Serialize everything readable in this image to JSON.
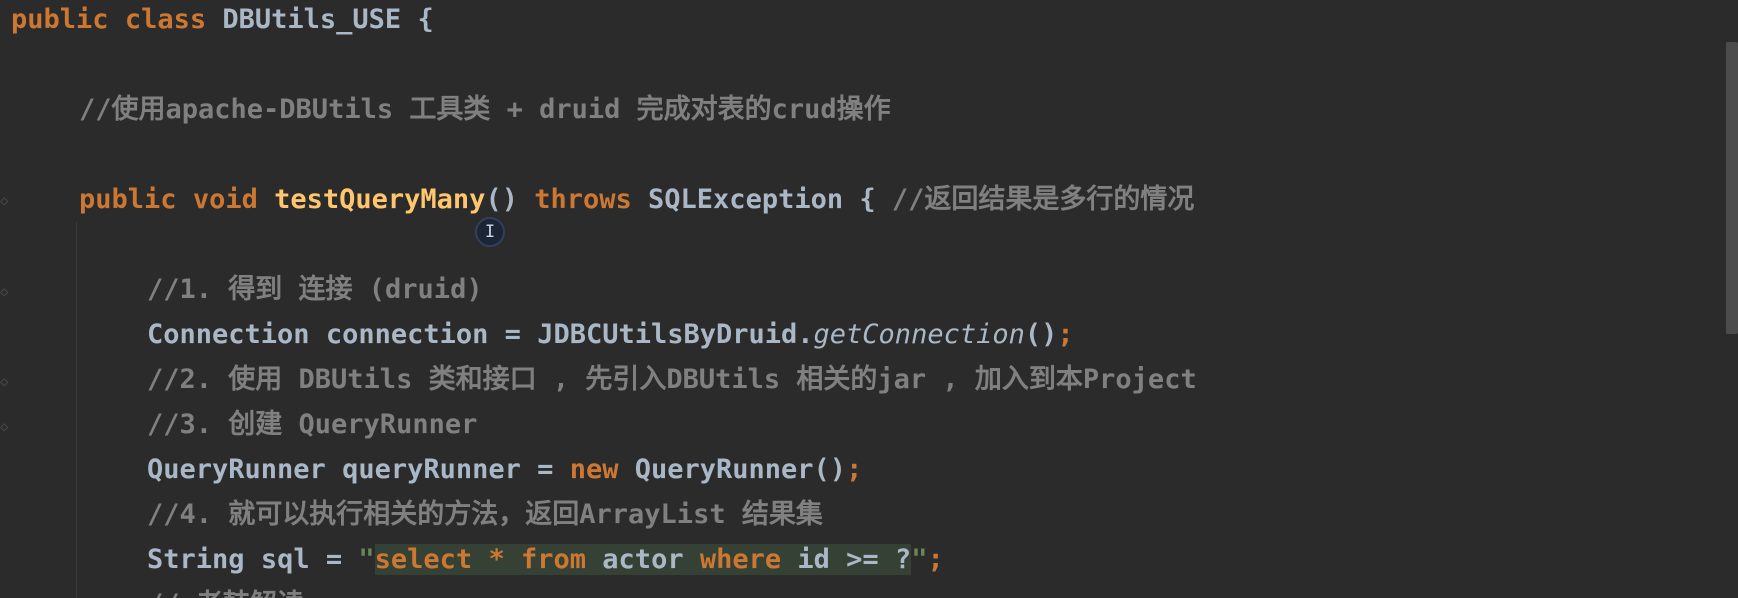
{
  "code": {
    "line1": {
      "kw_public": "public",
      "kw_class": "class",
      "class_name": "DBUtils_USE",
      "brace": "{"
    },
    "line2": {
      "comment": "//使用apache-DBUtils 工具类 + druid 完成对表的crud操作"
    },
    "line3": {
      "kw_public": "public",
      "kw_void": "void",
      "method_name": "testQueryMany",
      "parens": "()",
      "kw_throws": "throws",
      "exception": "SQLException",
      "brace": "{",
      "comment": "//返回结果是多行的情况"
    },
    "line4": {
      "comment": "//1. 得到 连接 (druid)"
    },
    "line5": {
      "type": "Connection",
      "var": "connection",
      "eq": "=",
      "util": "JDBCUtilsByDruid.",
      "call": "getConnection",
      "parens": "()",
      "semi": ";"
    },
    "line6": {
      "comment": "//2. 使用 DBUtils 类和接口 , 先引入DBUtils 相关的jar , 加入到本Project"
    },
    "line7": {
      "comment": "//3. 创建 QueryRunner"
    },
    "line8": {
      "type": "QueryRunner",
      "var": "queryRunner",
      "eq": "=",
      "kw_new": "new",
      "ctor": "QueryRunner()",
      "semi": ";"
    },
    "line9": {
      "comment": "//4. 就可以执行相关的方法，返回ArrayList 结果集"
    },
    "line10": {
      "type": "String",
      "var": "sql",
      "eq": "=",
      "quote_open": "\"",
      "sql_select": "select",
      "sql_star": "*",
      "sql_from": "from",
      "sql_table": "actor",
      "sql_where": "where",
      "sql_cond": "id >= ?",
      "quote_close": "\"",
      "semi": ";"
    },
    "line11": {
      "comment": "// 老韩解读"
    }
  },
  "colors": {
    "background": "#2b2b2b",
    "keyword": "#cc7832",
    "method": "#ffc66d",
    "comment": "#808080",
    "identifier": "#a9b7c6",
    "sql_injection_bg": "#364135"
  },
  "icons": {
    "mouse_cursor": "text-cursor-icon"
  }
}
